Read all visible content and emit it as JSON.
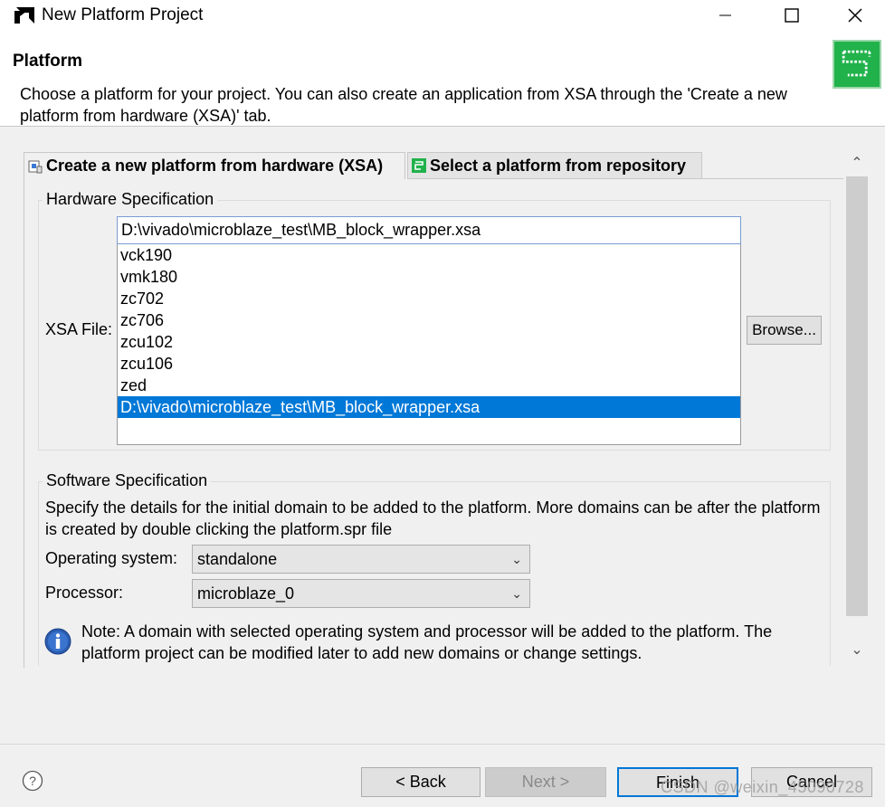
{
  "window": {
    "title": "New Platform Project"
  },
  "header": {
    "title": "Platform",
    "description": "Choose a platform for your project. You can also create an application from XSA through the 'Create a new platform from hardware (XSA)' tab."
  },
  "tabs": [
    {
      "label": "Create a new platform from hardware (XSA)",
      "icon": "hardware-chip-icon",
      "active": true
    },
    {
      "label": "Select a platform from repository",
      "icon": "platform-repo-icon",
      "active": false
    }
  ],
  "hardware": {
    "legend": "Hardware Specification",
    "xsa_label": "XSA File:",
    "xsa_value": "D:\\vivado\\microblaze_test\\MB_block_wrapper.xsa",
    "options": [
      "vck190",
      "vmk180",
      "zc702",
      "zc706",
      "zcu102",
      "zcu106",
      "zed",
      "D:\\vivado\\microblaze_test\\MB_block_wrapper.xsa"
    ],
    "selected_index": 7,
    "browse_label": "Browse..."
  },
  "software": {
    "legend": "Software Specification",
    "description": "Specify the details for the initial domain to be added to the platform. More domains can be after the platform is created by double clicking the platform.spr file",
    "os_label": "Operating system:",
    "os_value": "standalone",
    "proc_label": "Processor:",
    "proc_value": "microblaze_0",
    "note": "Note: A domain with selected operating system and processor will be added to the platform. The platform project can be modified later to add new domains or change settings."
  },
  "buttons": {
    "back": "< Back",
    "next": "Next >",
    "finish": "Finish",
    "cancel": "Cancel"
  },
  "watermark": "CSDN @weixin_45090728",
  "colors": {
    "selection": "#0078d7",
    "badge": "#21b24b",
    "info": "#2a5db0"
  }
}
